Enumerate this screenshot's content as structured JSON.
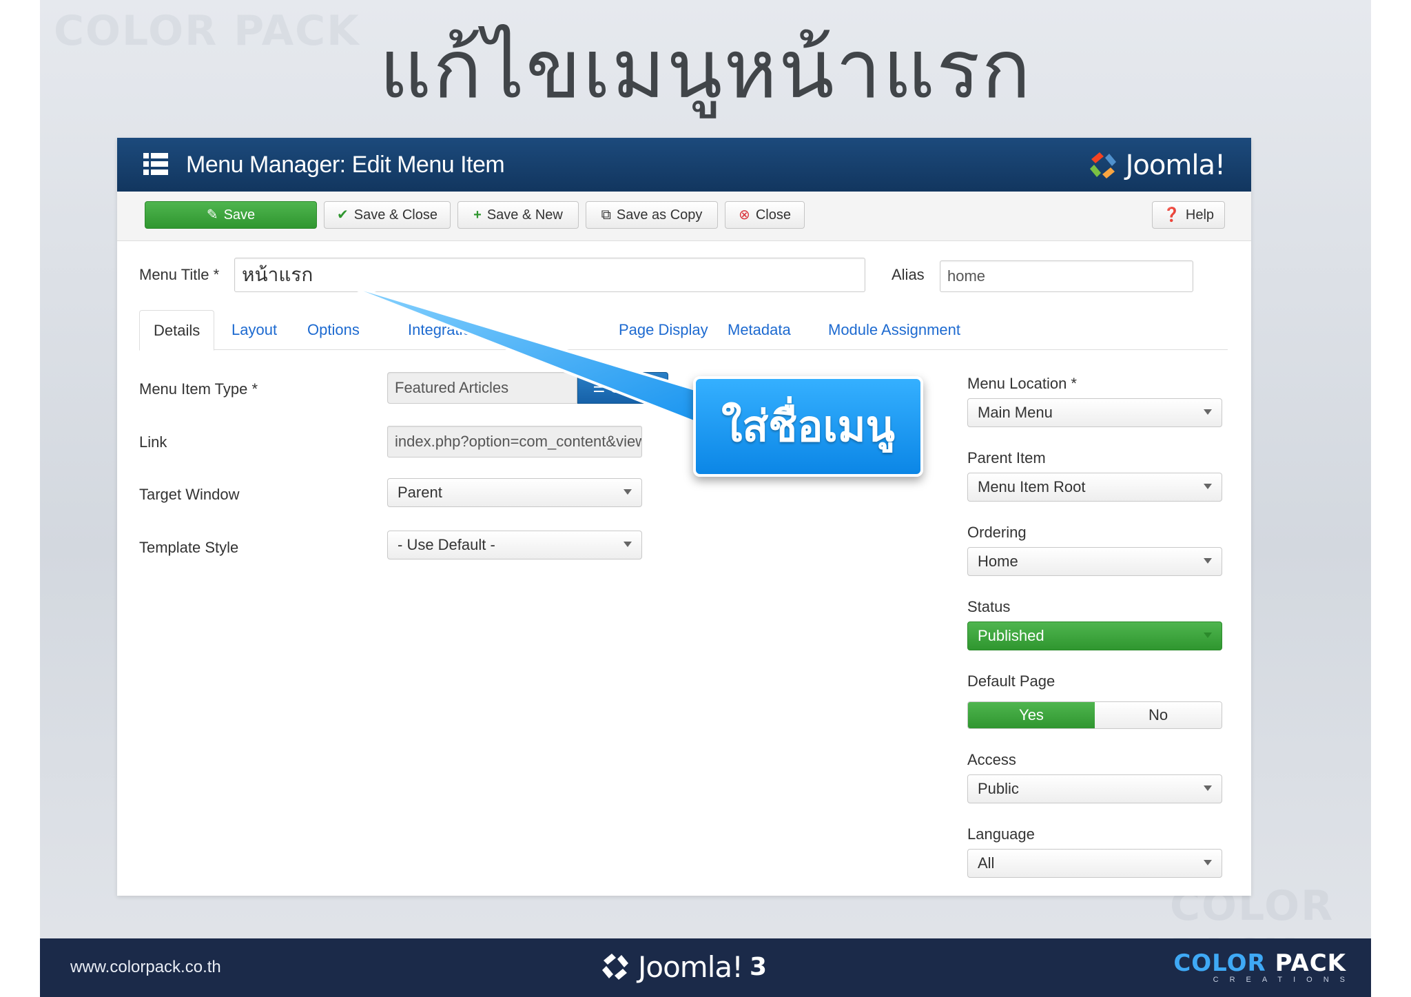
{
  "slide": {
    "title": "แก้ไขเมนูหน้าแรก",
    "callout_text": "ใส่ชื่อเมนู"
  },
  "header": {
    "title": "Menu Manager: Edit Menu Item",
    "logo_text": "Joomla!"
  },
  "toolbar": {
    "save": "Save",
    "save_close": "Save & Close",
    "save_new": "Save & New",
    "save_copy": "Save as Copy",
    "close": "Close",
    "help": "Help"
  },
  "form": {
    "menu_title_label": "Menu Title *",
    "menu_title_value": "หน้าแรก",
    "alias_label": "Alias",
    "alias_value": "home"
  },
  "tabs": [
    "Details",
    "Layout",
    "Options",
    "Integration",
    "Page Display",
    "Metadata",
    "Module Assignment"
  ],
  "details": {
    "menu_item_type_label": "Menu Item Type *",
    "menu_item_type_value": "Featured Articles",
    "select_button": "Select",
    "link_label": "Link",
    "link_value": "index.php?option=com_content&view=featured",
    "target_window_label": "Target Window",
    "target_window_value": "Parent",
    "template_style_label": "Template Style",
    "template_style_value": "- Use Default -"
  },
  "sidebar": {
    "menu_location_label": "Menu Location *",
    "menu_location_value": "Main Menu",
    "parent_item_label": "Parent Item",
    "parent_item_value": "Menu Item Root",
    "ordering_label": "Ordering",
    "ordering_value": "Home",
    "status_label": "Status",
    "status_value": "Published",
    "default_page_label": "Default Page",
    "default_yes": "Yes",
    "default_no": "No",
    "access_label": "Access",
    "access_value": "Public",
    "language_label": "Language",
    "language_value": "All"
  },
  "footer": {
    "url": "www.colorpack.co.th",
    "center_logo": "Joomla!",
    "center_version": "3",
    "brand_color": "COLOR",
    "brand_pack": "PACK",
    "brand_sub": "CREATIONS"
  },
  "colors": {
    "header_blue": "#12365f",
    "save_green": "#3aa63a",
    "link_blue": "#1d6ad0",
    "callout_blue": "#1a95f0",
    "footer_navy": "#1b2a49"
  }
}
